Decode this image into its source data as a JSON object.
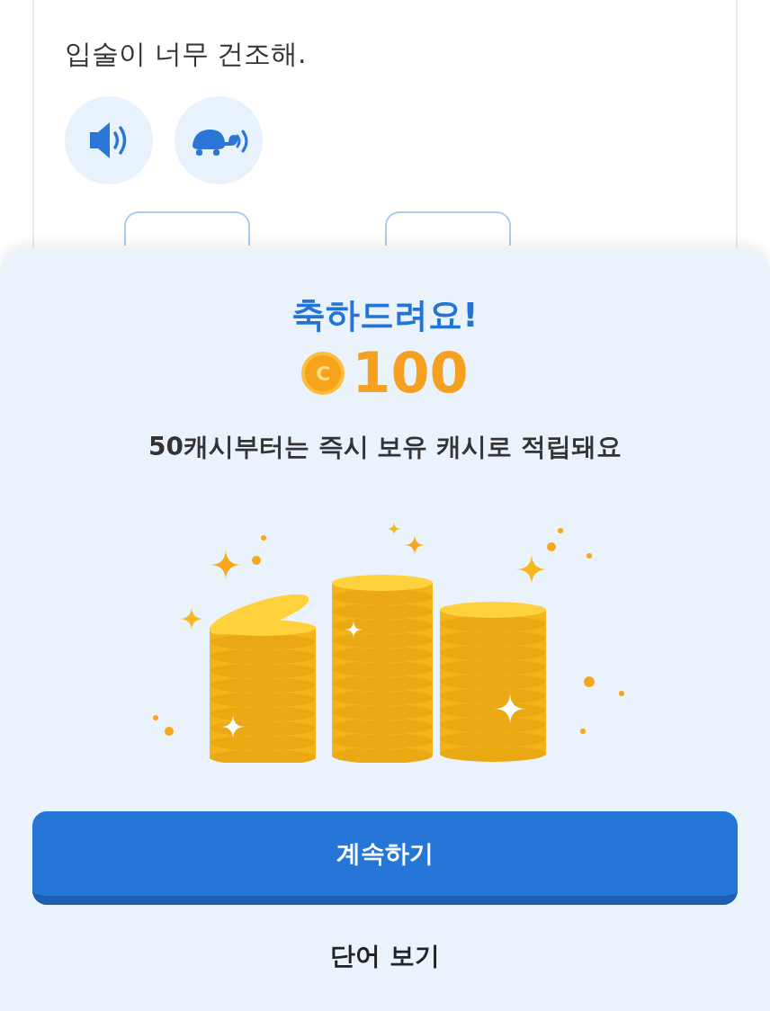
{
  "card": {
    "sentence": "입술이 너무 건조해.",
    "audio_buttons": [
      {
        "kind": "normal"
      },
      {
        "kind": "slow"
      }
    ],
    "blanks": [
      {
        "kind": "blank"
      },
      {
        "kind": "blank"
      }
    ]
  },
  "sheet": {
    "title": "축하드려요!",
    "coin_symbol": "C",
    "amount": "100",
    "message": "50캐시부터는 즉시 보유 캐시로 적립돼요",
    "primary_button": "계속하기",
    "secondary_button": "단어 보기"
  }
}
